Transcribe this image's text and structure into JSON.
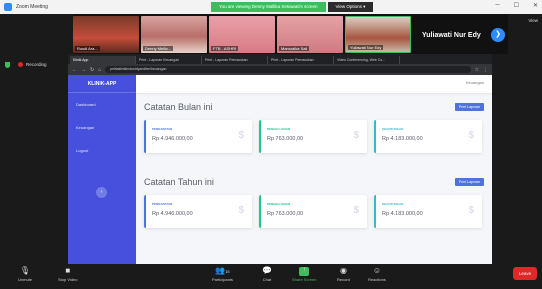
{
  "zoom": {
    "title": "Zoom Meeting",
    "share_message": "You are viewing Denny Mallika Setiawati's screen",
    "view_options": "View Options ▾",
    "speaker_name": "Yuliawati Nur Edy",
    "view_label": "View",
    "recording_label": "Recording",
    "participants": [
      {
        "name": "Rusdi Ara..."
      },
      {
        "name": "Denny Meiliz..."
      },
      {
        "name": "FTB - ASHRI"
      },
      {
        "name": "Mamoalka Sali"
      },
      {
        "name": "Yuliawati Nur Edy"
      }
    ],
    "toolbar": {
      "unmute": "Unmute",
      "stop_video": "Stop Video",
      "participants": "Participants",
      "participants_count": "15",
      "chat": "Chat",
      "share_screen": "Share Screen",
      "record": "Record",
      "reactions": "Reactions",
      "leave": "Leave"
    }
  },
  "browser": {
    "tabs": [
      "Klinik App",
      "Print - Laporan Keuangan",
      "Print - Laporan Pemasukan",
      "Print - Laporan Pemasukan",
      "Video Conferencing, Web Co..."
    ],
    "url": "pelitaklinikindustriyandtbe/keuangan"
  },
  "app": {
    "brand": "KLINIK-APP",
    "sidebar": [
      "Dashboard",
      "Keuangan",
      "Logout"
    ],
    "topnav_user": "Keuangan",
    "sections": [
      {
        "title": "Catatan Bulan ini",
        "print_label": "Print Laporan",
        "cards": [
          {
            "label": "PENDAPATAN",
            "value": "Rp 4.946.000,00",
            "icon": "$"
          },
          {
            "label": "PENGELUARAN",
            "value": "Rp 763.000,00",
            "icon": "$"
          },
          {
            "label": "KEUNTUNGAN",
            "value": "Rp 4.183.000,00",
            "icon": "$"
          }
        ]
      },
      {
        "title": "Catatan Tahun ini",
        "print_label": "Print Laporan",
        "cards": [
          {
            "label": "PENDAPATAN",
            "value": "Rp 4.946.000,00",
            "icon": "$"
          },
          {
            "label": "PENGELUARAN",
            "value": "Rp 763.000,00",
            "icon": "$"
          },
          {
            "label": "KEUNTUNGAN",
            "value": "Rp 4.183.000,00",
            "icon": "$"
          }
        ]
      }
    ]
  },
  "colors": {
    "primary": "#4e73df",
    "success": "#1cc88a",
    "info": "#36b9cc",
    "sidebar": "#4650dd",
    "zoom_green": "#3dbd5d",
    "leave_red": "#e02828"
  }
}
